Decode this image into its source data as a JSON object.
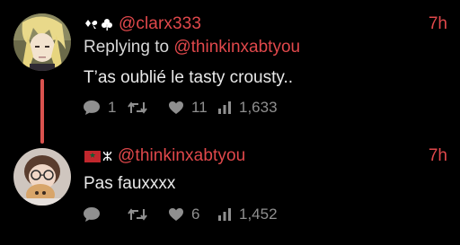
{
  "tweets": [
    {
      "badges": [
        "spade-bow-emoji",
        "shamrock-emoji"
      ],
      "handle": "@clarx333",
      "time": "7h",
      "reply_prefix": "Replying to",
      "reply_handle": "@thinkinxabtyou",
      "text": "T’as oublié le tasty crousty..",
      "replies": "1",
      "retweets": "",
      "likes": "11",
      "views": "1,633"
    },
    {
      "badges": [
        "morocco-flag-emoji",
        "amazigh-symbol"
      ],
      "badge_symbol": "ⵣ",
      "handle": "@thinkinxabtyou",
      "time": "7h",
      "text": "Pas fauxxxx",
      "replies": "",
      "retweets": "",
      "likes": "6",
      "views": "1,452"
    }
  ],
  "colors": {
    "background": "#000000",
    "accent": "#e0484b",
    "thread_line": "#d9534f",
    "icon_gray": "#8f8f8f"
  }
}
